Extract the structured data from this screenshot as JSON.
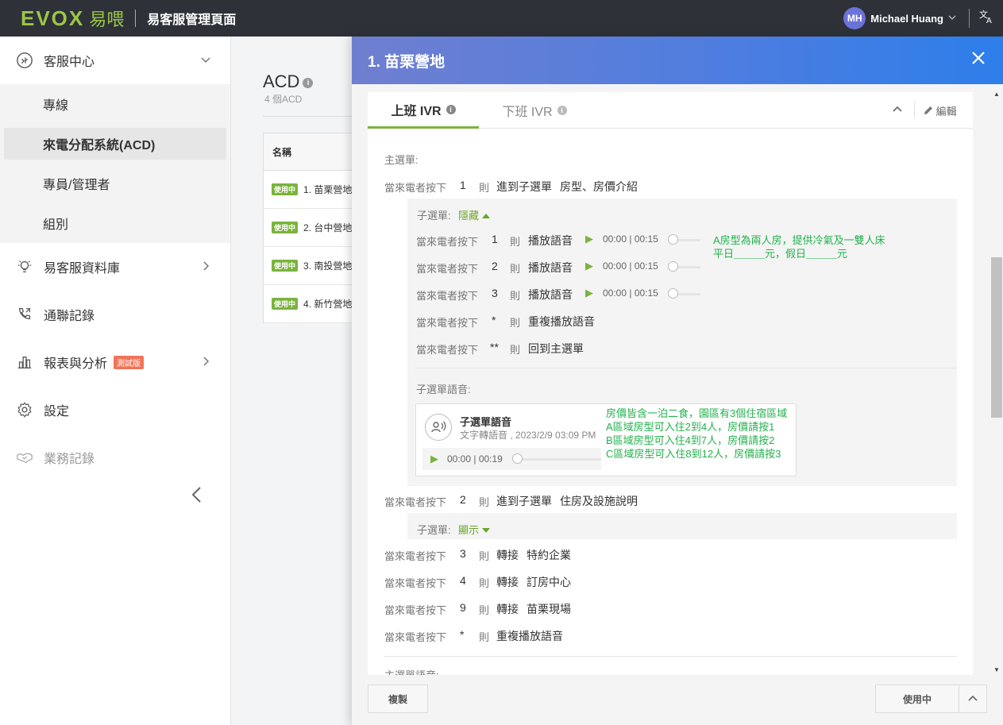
{
  "topbar": {
    "logo_evox": "EVOX",
    "logo_yi": "易喂",
    "title": "易客服管理頁面",
    "avatar": "MH",
    "user_name": "Michael Huang",
    "chevron_icon": "chevron-down-icon",
    "lang_icon": "translate-icon"
  },
  "sidebar": {
    "items": [
      {
        "label": "客服中心",
        "icon": "headset-icon"
      },
      {
        "label": "易客服資料庫",
        "icon": "bulb-icon"
      },
      {
        "label": "通聯記錄",
        "icon": "phone-icon"
      },
      {
        "label": "報表與分析",
        "icon": "chart-icon",
        "badge": "測試版"
      },
      {
        "label": "設定",
        "icon": "gear-icon"
      },
      {
        "label": "業務記錄",
        "icon": "handshake-icon"
      }
    ],
    "sub_items": [
      "專線",
      "來電分配系統(ACD)",
      "專員/管理者",
      "組別"
    ]
  },
  "main": {
    "title": "ACD",
    "count": "4 個ACD",
    "table_header": "名稱",
    "badge": "使用中",
    "rows": [
      "1. 苗栗營地",
      "2. 台中營地",
      "3. 南投營地",
      "4. 新竹營地"
    ]
  },
  "drawer": {
    "title": "1. 苗栗營地",
    "tabs": [
      "上班 IVR",
      "下班 IVR"
    ],
    "edit": "編輯",
    "main_menu_label": "主選單:",
    "press_label": "當來電者按下",
    "then": "則",
    "rules": [
      {
        "key": "1",
        "action": "進到子選單",
        "target": "房型、房價介紹"
      },
      {
        "key": "2",
        "action": "進到子選單",
        "target": "住房及設施說明"
      },
      {
        "key": "3",
        "action": "轉接",
        "target": "特約企業"
      },
      {
        "key": "4",
        "action": "轉接",
        "target": "訂房中心"
      },
      {
        "key": "9",
        "action": "轉接",
        "target": "苗栗現場"
      },
      {
        "key": "*",
        "action": "重複播放語音",
        "target": ""
      }
    ],
    "submenu_label": "子選單:",
    "hide_label": "隱藏",
    "show_label": "顯示",
    "sub_rules": [
      {
        "key": "1",
        "action": "播放語音",
        "time": "00:00 | 00:15"
      },
      {
        "key": "2",
        "action": "播放語音",
        "time": "00:00 | 00:15"
      },
      {
        "key": "3",
        "action": "播放語音",
        "time": "00:00 | 00:15"
      },
      {
        "key": "*",
        "action": "重複播放語音"
      },
      {
        "key": "**",
        "action": "回到主選單"
      }
    ],
    "anno_1": [
      "A房型為兩人房，提供冷氣及一雙人床",
      "平日＿＿＿元，假日＿＿＿元"
    ],
    "sub_voice_label": "子選單語音:",
    "voice_card": {
      "title": "子選單語音",
      "meta": "文字轉語音 , 2023/2/9 03:09 PM",
      "time": "00:00 | 00:19"
    },
    "anno_2": [
      "房價皆含一泊二食，園區有3個住宿區域",
      "A區域房型可入住2到4人，房價請按1",
      "B區域房型可入住4到7人，房價請按2",
      "C區域房型可入住8到12人，房價請按3"
    ],
    "main_voice_label": "主選單語音:",
    "copy_btn": "複製",
    "status_btn": "使用中",
    "colors": {
      "accent": "#7bb33e",
      "annotation": "#22b14c",
      "header_start": "#6f7fd0",
      "header_end": "#2d7eea"
    }
  }
}
